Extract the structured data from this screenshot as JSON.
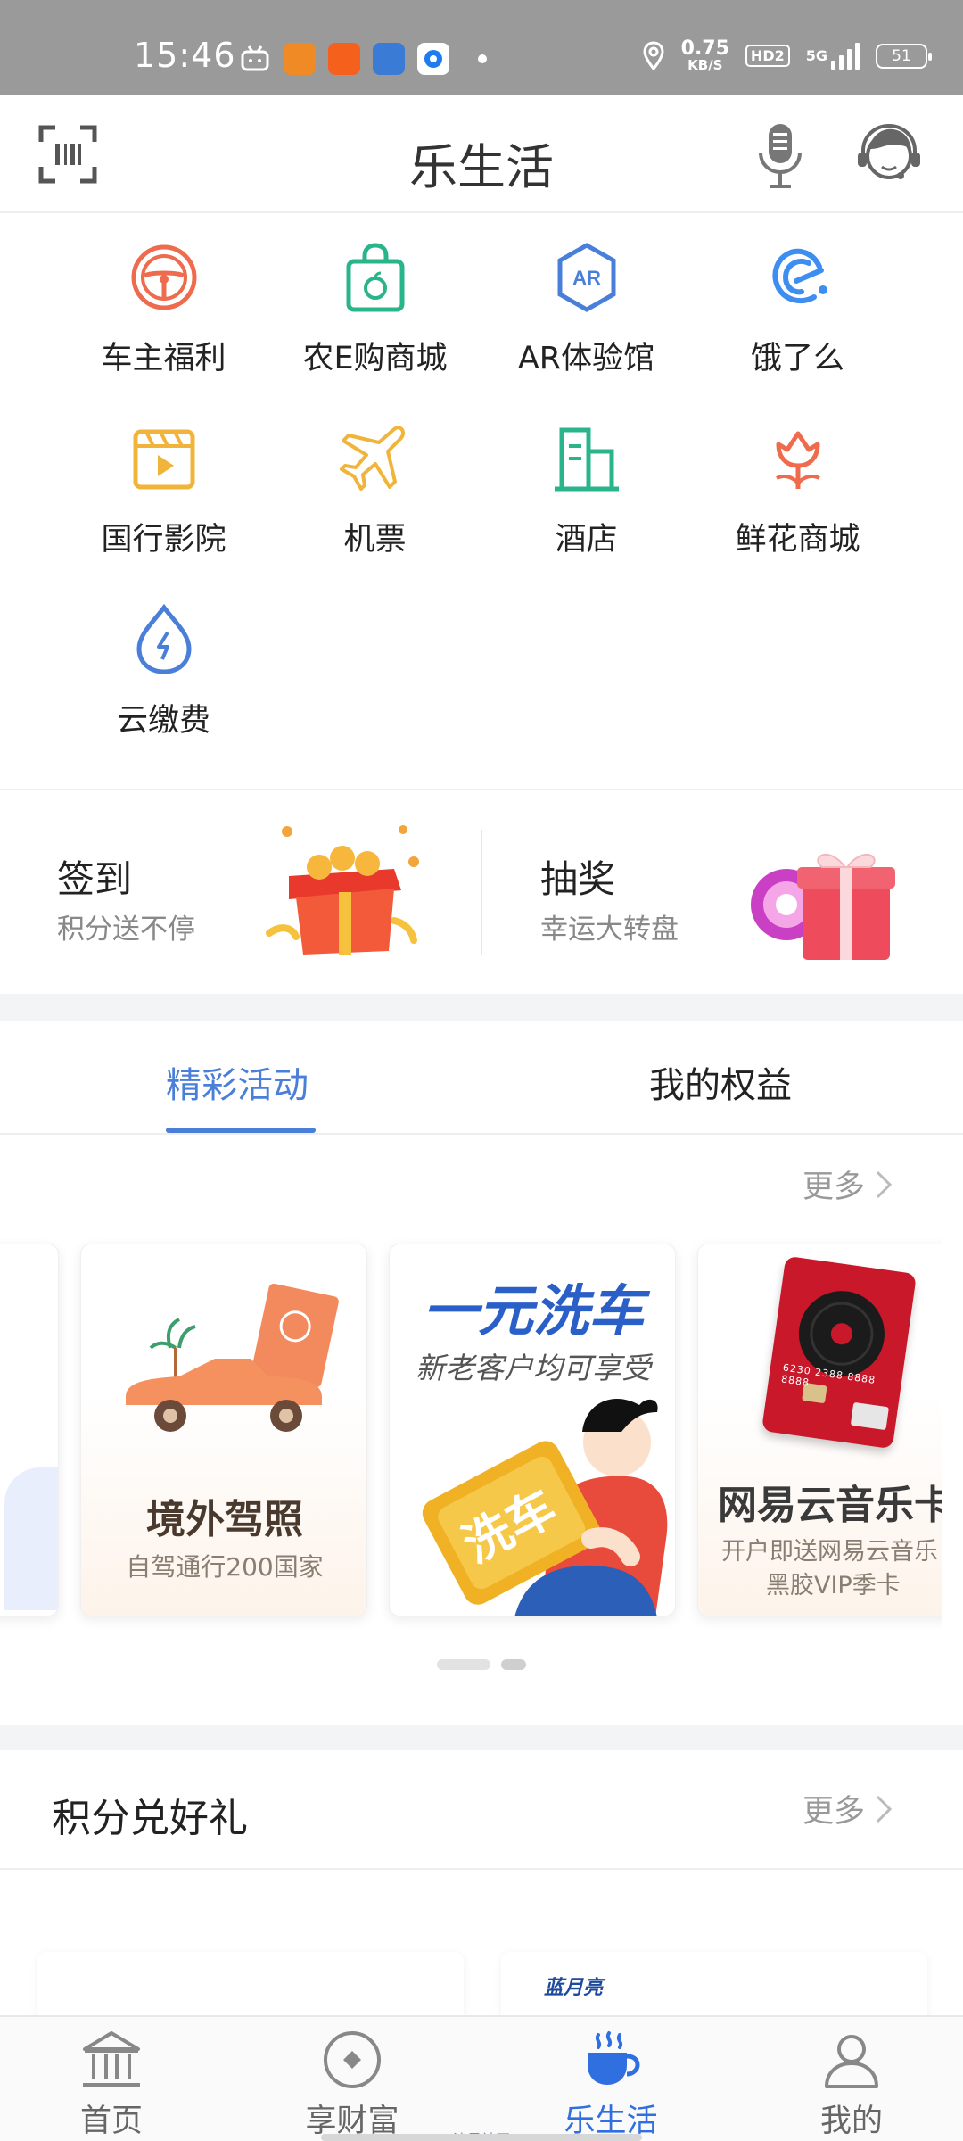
{
  "status_bar": {
    "time": "15:46",
    "net_speed_value": "0.75",
    "net_speed_unit": "KB/S",
    "hd_badge": "HD2",
    "network": "5G",
    "battery": "51"
  },
  "header": {
    "title": "乐生活"
  },
  "services": [
    {
      "label": "车主福利",
      "icon": "steering-wheel-icon"
    },
    {
      "label": "农E购商城",
      "icon": "shopping-bag-icon"
    },
    {
      "label": "AR体验馆",
      "icon": "ar-icon"
    },
    {
      "label": "饿了么",
      "icon": "eleme-icon"
    },
    {
      "label": "国行影院",
      "icon": "cinema-icon"
    },
    {
      "label": "机票",
      "icon": "airplane-icon"
    },
    {
      "label": "酒店",
      "icon": "hotel-icon"
    },
    {
      "label": "鲜花商城",
      "icon": "flower-icon"
    },
    {
      "label": "云缴费",
      "icon": "bill-payment-icon"
    }
  ],
  "promo": {
    "signin": {
      "title": "签到",
      "subtitle": "积分送不停"
    },
    "lottery": {
      "title": "抽奖",
      "subtitle": "幸运大转盘"
    }
  },
  "tabs": [
    {
      "label": "精彩活动",
      "active": true
    },
    {
      "label": "我的权益",
      "active": false
    }
  ],
  "activities": {
    "more_label": "更多",
    "cards": [
      {
        "title": "境外驾照",
        "subtitle": "自驾通行200国家"
      },
      {
        "headline": "一元洗车",
        "subtitle": "新老客户均可享受",
        "badge": "洗车"
      },
      {
        "title": "网易云音乐卡",
        "subtitle_line1": "开户即送网易云音乐",
        "subtitle_line2": "黑胶VIP季卡",
        "card_numbers": "6230 2388 8888 8888"
      }
    ],
    "page_count": 2,
    "current_page": 2
  },
  "points": {
    "title": "积分兑好礼",
    "more_label": "更多",
    "partial_item_text": "蓝月亮"
  },
  "bottom_nav": {
    "items": [
      {
        "label": "首页",
        "icon": "bank-icon",
        "active": false
      },
      {
        "label": "享财富",
        "icon": "wealth-icon",
        "active": false
      },
      {
        "label": "乐生活",
        "icon": "coffee-cup-icon",
        "active": true
      },
      {
        "label": "我的",
        "icon": "person-icon",
        "active": false
      }
    ],
    "sub_text": "流星社区"
  },
  "colors": {
    "accent": "#4a7fd9",
    "nav_active": "#2f6fe0",
    "status_bar": "#9a9a9a"
  }
}
